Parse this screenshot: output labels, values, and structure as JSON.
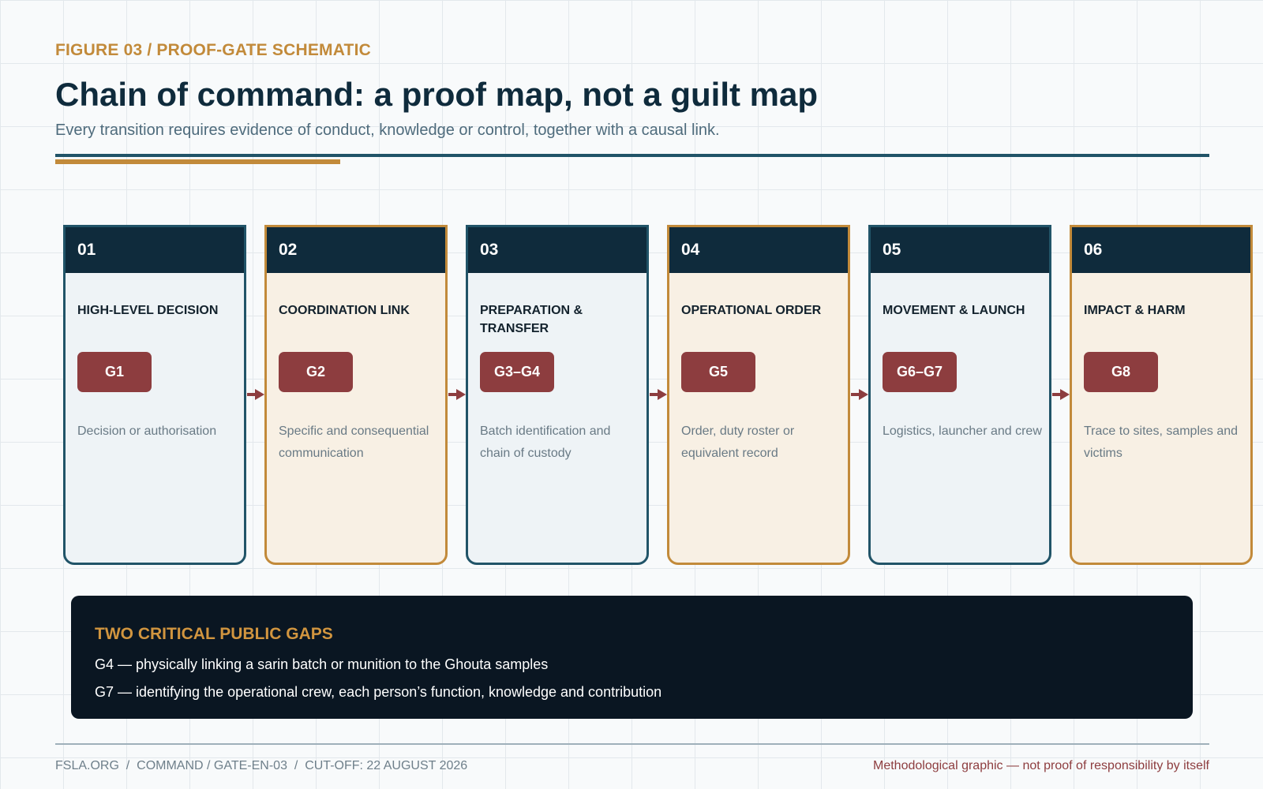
{
  "header": {
    "kicker": "FIGURE 03 / PROOF-GATE SCHEMATIC",
    "title": "Chain of command: a proof map, not a guilt map",
    "subtitle": "Every transition requires evidence of conduct, knowledge or control, together with a causal link."
  },
  "stages": [
    {
      "number": "01",
      "title": "HIGH-LEVEL DECISION",
      "gate": "G1",
      "note": "Decision or authorisation"
    },
    {
      "number": "02",
      "title": "COORDINATION LINK",
      "gate": "G2",
      "note": "Specific and consequential communication"
    },
    {
      "number": "03",
      "title": "PREPARATION & TRANSFER",
      "gate": "G3–G4",
      "note": "Batch identification and chain of custody"
    },
    {
      "number": "04",
      "title": "OPERATIONAL ORDER",
      "gate": "G5",
      "note": "Order, duty roster or equivalent record"
    },
    {
      "number": "05",
      "title": "MOVEMENT & LAUNCH",
      "gate": "G6–G7",
      "note": "Logistics, launcher and crew"
    },
    {
      "number": "06",
      "title": "IMPACT & HARM",
      "gate": "G8",
      "note": "Trace to sites, samples and victims"
    }
  ],
  "gaps": {
    "title": "TWO CRITICAL PUBLIC GAPS",
    "items": [
      "G4 — physically linking a sarin batch or munition to the Ghouta samples",
      "G7 — identifying the operational crew, each person’s function, knowledge and contribution"
    ]
  },
  "footer": {
    "left": "FSLA.ORG  /  COMMAND / GATE-EN-03  /  CUT-OFF: 22 AUGUST 2026",
    "right": "Methodological graphic — not proof of responsibility by itself"
  },
  "colors": {
    "navy": "#0f2b3c",
    "blue_border": "#215468",
    "gold": "#c28a3a",
    "gate_red": "#8d3d3f",
    "panel_dark": "#0a1622"
  }
}
